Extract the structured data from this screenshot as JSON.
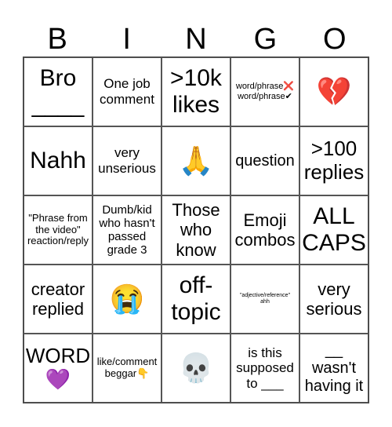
{
  "header": [
    "B",
    "I",
    "N",
    "G",
    "O"
  ],
  "cells": [
    {
      "text": "Bro\n____",
      "size": "s30"
    },
    {
      "text": "One job\ncomment",
      "size": "s17"
    },
    {
      "text": ">10k\nlikes",
      "size": "s30"
    },
    {
      "text": "word/phrase❌\nword/phrase✔",
      "size": "s11"
    },
    {
      "text": "💔",
      "size": "emoji"
    },
    {
      "text": "Nahh",
      "size": "s30"
    },
    {
      "text": "very\nunserious",
      "size": "s17"
    },
    {
      "text": "🙏",
      "size": "emoji"
    },
    {
      "text": "question",
      "size": "s20"
    },
    {
      "text": ">100\nreplies",
      "size": "s26"
    },
    {
      "text": "\"Phrase from\nthe video\"\nreaction/reply",
      "size": "s13"
    },
    {
      "text": "Dumb/kid\nwho hasn't\npassed\ngrade 3",
      "size": "s15"
    },
    {
      "text": "Those\nwho\nknow",
      "size": "s22"
    },
    {
      "text": "Emoji\ncombos",
      "size": "s22"
    },
    {
      "text": "ALL\nCAPS",
      "size": "s30"
    },
    {
      "text": "creator\nreplied",
      "size": "s22"
    },
    {
      "text": "😭",
      "size": "emoji"
    },
    {
      "text": "off-\ntopic",
      "size": "s30"
    },
    {
      "text": "\"adjective/reference\"\nahh",
      "size": "s7"
    },
    {
      "text": "very\nserious",
      "size": "s22"
    },
    {
      "text": "WORD\n💜",
      "size": "s26"
    },
    {
      "text": "like/comment\nbeggar👇",
      "size": "s13"
    },
    {
      "text": "💀",
      "size": "emoji"
    },
    {
      "text": "is this\nsupposed\nto ___",
      "size": "s17"
    },
    {
      "text": "__\nwasn't\nhaving it",
      "size": "s20"
    }
  ]
}
